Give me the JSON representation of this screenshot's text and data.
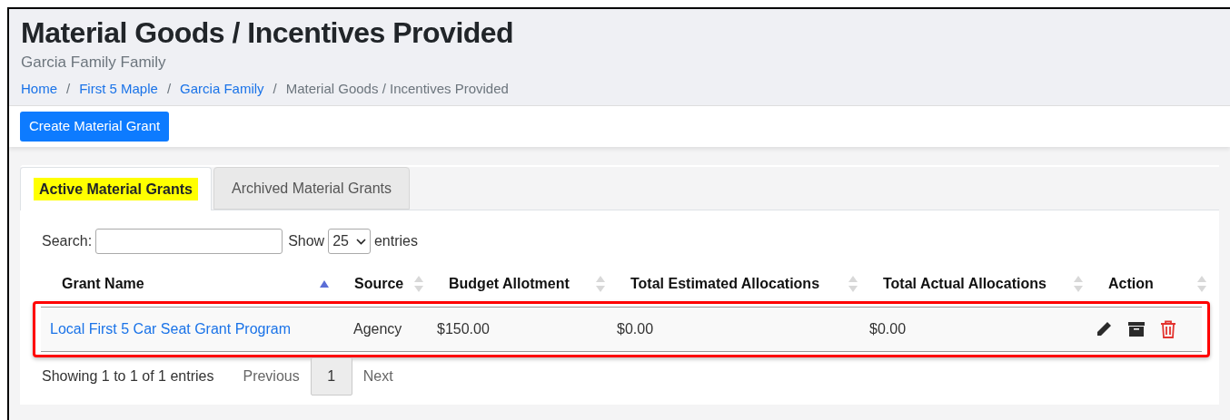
{
  "page": {
    "title": "Material Goods / Incentives Provided",
    "subtitle": "Garcia Family Family"
  },
  "breadcrumb": [
    {
      "label": "Home",
      "link": true
    },
    {
      "label": "First 5 Maple",
      "link": true
    },
    {
      "label": "Garcia Family",
      "link": true
    },
    {
      "label": "Material Goods / Incentives Provided",
      "link": false
    }
  ],
  "breadcrumb_separator": "/",
  "create_button": "Create Material Grant",
  "tabs": [
    {
      "label": "Active Material Grants",
      "selected": true,
      "highlighted": true
    },
    {
      "label": "Archived Material Grants",
      "selected": false,
      "highlighted": false
    }
  ],
  "search": {
    "label": "Search:"
  },
  "length": {
    "before": "Show",
    "value": "25",
    "after": "entries"
  },
  "table": {
    "columns": [
      {
        "label": "Grant Name",
        "sorted": true
      },
      {
        "label": "Source",
        "sorted": false
      },
      {
        "label": "Budget Allotment",
        "sorted": false
      },
      {
        "label": "Total Estimated Allocations",
        "sorted": false
      },
      {
        "label": "Total Actual Allocations",
        "sorted": false
      },
      {
        "label": "Action",
        "sorted": false
      }
    ],
    "rows": [
      {
        "grant_name": "Local First 5 Car Seat Grant Program",
        "source": "Agency",
        "budget_allotment": "$150.00",
        "total_estimated": "$0.00",
        "total_actual": "$0.00",
        "outlined": true
      }
    ]
  },
  "info": "Showing 1 to 1 of 1 entries",
  "pagination": [
    {
      "label": "Previous",
      "kind": "nav",
      "selected": false
    },
    {
      "label": "1",
      "kind": "page",
      "selected": true
    },
    {
      "label": "Next",
      "kind": "nav",
      "selected": false
    }
  ]
}
